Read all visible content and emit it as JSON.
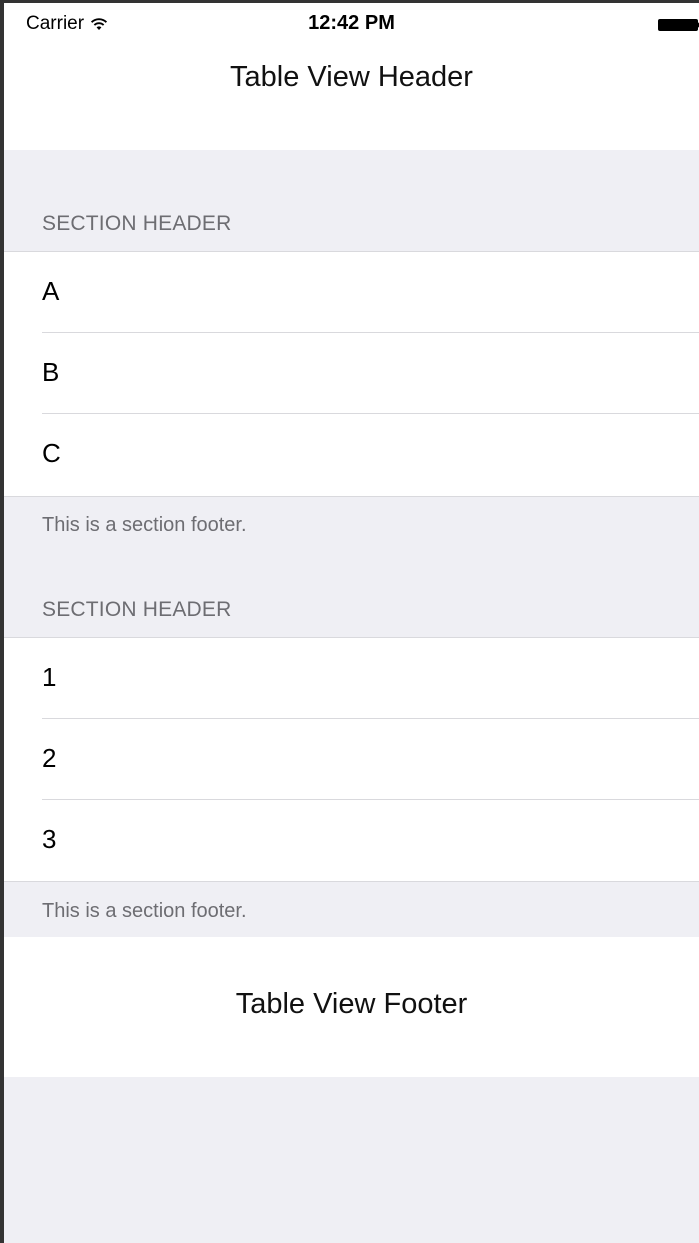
{
  "status_bar": {
    "carrier": "Carrier",
    "time": "12:42 PM",
    "wifi_icon": "wifi-icon",
    "battery_icon": "battery-icon"
  },
  "table": {
    "header_title": "Table View Header",
    "footer_title": "Table View Footer",
    "sections": [
      {
        "header": "SECTION HEADER",
        "rows": [
          "A",
          "B",
          "C"
        ],
        "footer": "This is a section footer."
      },
      {
        "header": "SECTION HEADER",
        "rows": [
          "1",
          "2",
          "3"
        ],
        "footer": "This is a section footer."
      }
    ]
  },
  "colors": {
    "grouped_background": "#efeff4",
    "cell_background": "#ffffff",
    "secondary_text": "#6d6d72",
    "separator": "#d9d9dd"
  }
}
